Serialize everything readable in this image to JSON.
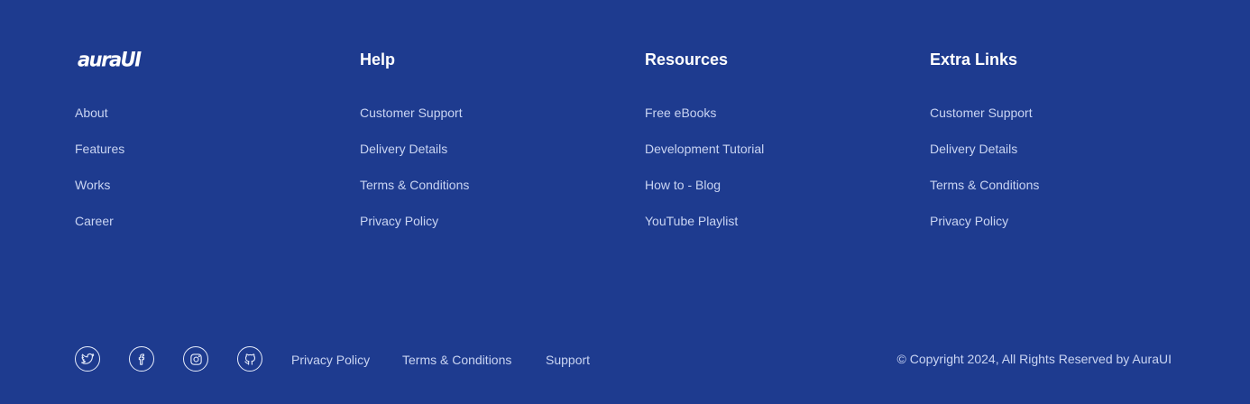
{
  "brand": {
    "logo_text": "auraUI"
  },
  "columns": [
    {
      "heading": "",
      "links": [
        "About",
        "Features",
        "Works",
        "Career"
      ]
    },
    {
      "heading": "Help",
      "links": [
        "Customer Support",
        "Delivery Details",
        "Terms & Conditions",
        "Privacy Policy"
      ]
    },
    {
      "heading": "Resources",
      "links": [
        "Free eBooks",
        "Development Tutorial",
        "How to - Blog",
        "YouTube Playlist"
      ]
    },
    {
      "heading": "Extra Links",
      "links": [
        "Customer Support",
        "Delivery Details",
        "Terms & Conditions",
        "Privacy Policy"
      ]
    }
  ],
  "social": {
    "icons": [
      "twitter-icon",
      "facebook-icon",
      "instagram-icon",
      "github-icon"
    ]
  },
  "bottom_links": [
    "Privacy Policy",
    "Terms & Conditions",
    "Support"
  ],
  "copyright": "© Copyright 2024, All Rights Reserved by AuraUI",
  "colors": {
    "background": "#1e3b8f",
    "heading": "#ffffff",
    "link": "#c9d4f2"
  }
}
